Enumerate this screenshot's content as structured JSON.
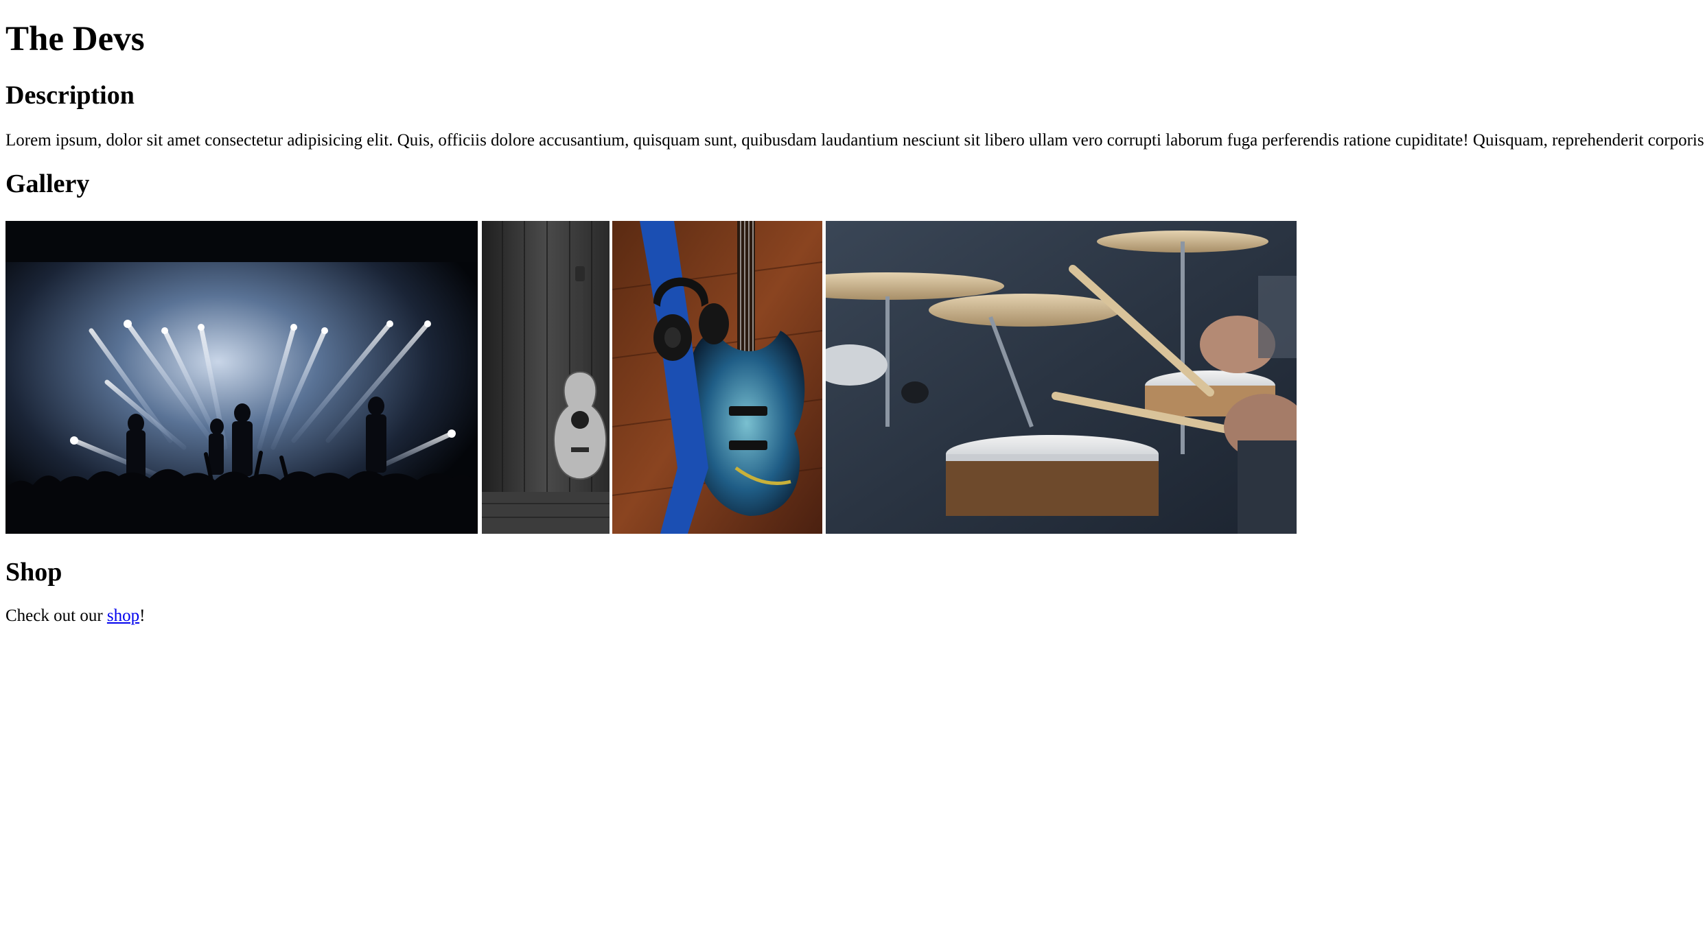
{
  "page": {
    "title": "The Devs"
  },
  "description": {
    "heading": "Description",
    "text": "Lorem ipsum, dolor sit amet consectetur adipisicing elit. Quis, officiis dolore accusantium, quisquam sunt, quibusdam laudantium nesciunt sit libero ullam vero corrupti laborum fuga perferendis ratione cupiditate! Quisquam, reprehenderit corporis!"
  },
  "gallery": {
    "heading": "Gallery",
    "images": [
      {
        "subject": "concert-stage-with-spotlights"
      },
      {
        "subject": "acoustic-guitar-against-door"
      },
      {
        "subject": "blue-bass-guitar-with-headphones"
      },
      {
        "subject": "drummer-playing-drum-kit"
      }
    ]
  },
  "shop": {
    "heading": "Shop",
    "text_before": "Check out our ",
    "link_label": "shop",
    "text_after": "!"
  },
  "colors": {
    "link": "#0000ee",
    "text": "#000000",
    "background": "#ffffff"
  }
}
